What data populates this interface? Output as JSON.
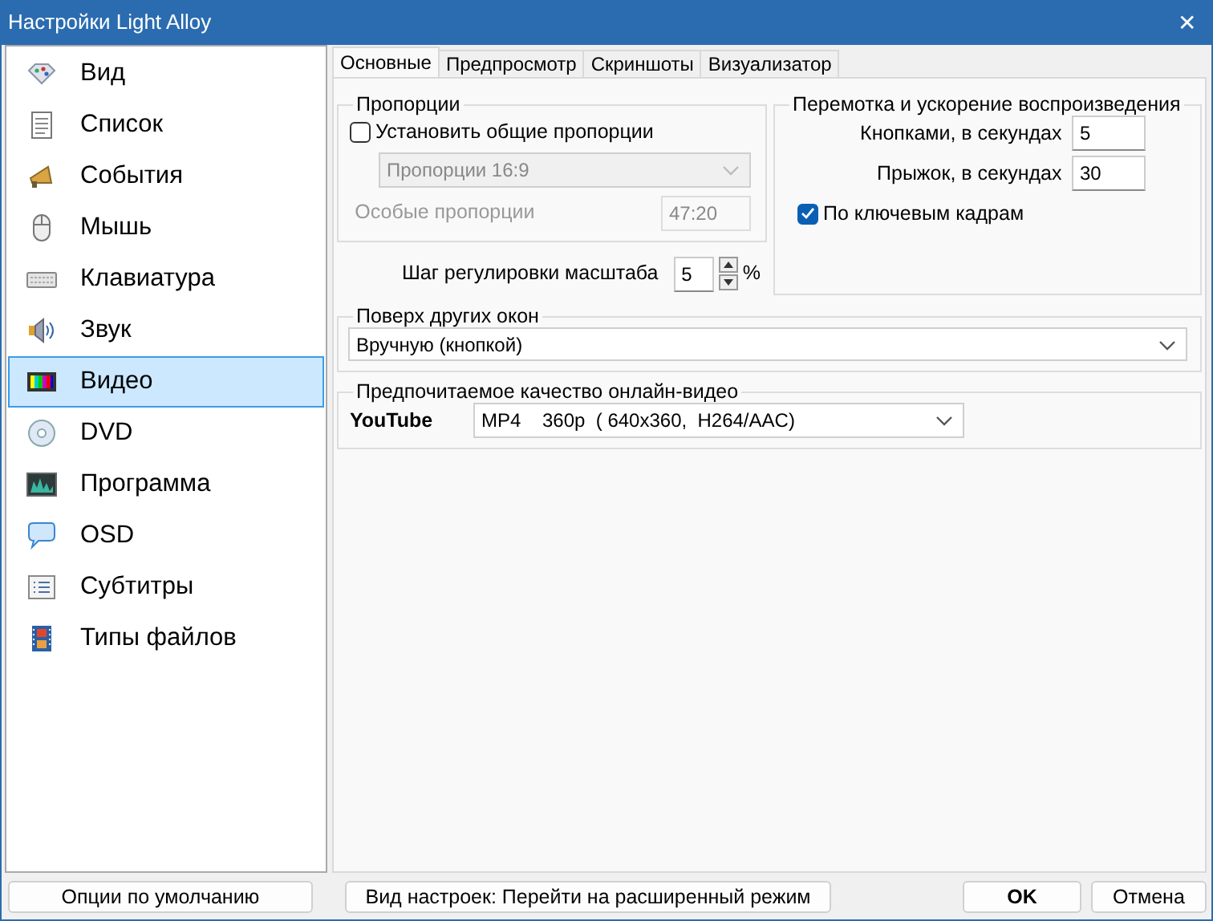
{
  "window": {
    "title": "Настройки Light Alloy",
    "close": "✕"
  },
  "sidebar": {
    "items": [
      {
        "label": "Вид",
        "selected": false
      },
      {
        "label": "Список",
        "selected": false
      },
      {
        "label": "События",
        "selected": false
      },
      {
        "label": "Мышь",
        "selected": false
      },
      {
        "label": "Клавиатура",
        "selected": false
      },
      {
        "label": "Звук",
        "selected": false
      },
      {
        "label": "Видео",
        "selected": true
      },
      {
        "label": "DVD",
        "selected": false
      },
      {
        "label": "Программа",
        "selected": false
      },
      {
        "label": "OSD",
        "selected": false
      },
      {
        "label": "Субтитры",
        "selected": false
      },
      {
        "label": "Типы файлов",
        "selected": false
      }
    ]
  },
  "tabs": [
    {
      "label": "Основные",
      "selected": true
    },
    {
      "label": "Предпросмотр",
      "selected": false
    },
    {
      "label": "Скриншоты",
      "selected": false
    },
    {
      "label": "Визуализатор",
      "selected": false
    }
  ],
  "proportions": {
    "title": "Пропорции",
    "checkbox": {
      "label": "Установить общие пропорции",
      "checked": false
    },
    "select": {
      "value": "Пропорции 16:9",
      "disabled": true
    },
    "custom": {
      "label": "Особые пропорции",
      "value": "47:20",
      "disabled": true
    }
  },
  "scale": {
    "label": "Шаг регулировки масштаба",
    "value": "5",
    "unit": "%"
  },
  "seek": {
    "title": "Перемотка и ускорение воспроизведения",
    "fields": [
      {
        "label": "Кнопками, в секундах",
        "value": "5"
      },
      {
        "label": "Прыжок, в секундах",
        "value": "30"
      }
    ],
    "checkbox": {
      "label": "По ключевым кадрам",
      "checked": true
    }
  },
  "on_top": {
    "title": "Поверх других окон",
    "value": "Вручную (кнопкой)"
  },
  "quality": {
    "title": "Предпочитаемое качество онлайн-видео",
    "label": "YouTube",
    "value": "MP4    360p  ( 640x360,  H264/AAC)"
  },
  "buttons": [
    {
      "label": "Опции по умолчанию",
      "kind": "default"
    },
    {
      "label": "Вид настроек: Перейти на расширенный режим",
      "kind": "mode"
    },
    {
      "label": "OK",
      "kind": "ok"
    },
    {
      "label": "Отмена",
      "kind": "cancel"
    }
  ]
}
